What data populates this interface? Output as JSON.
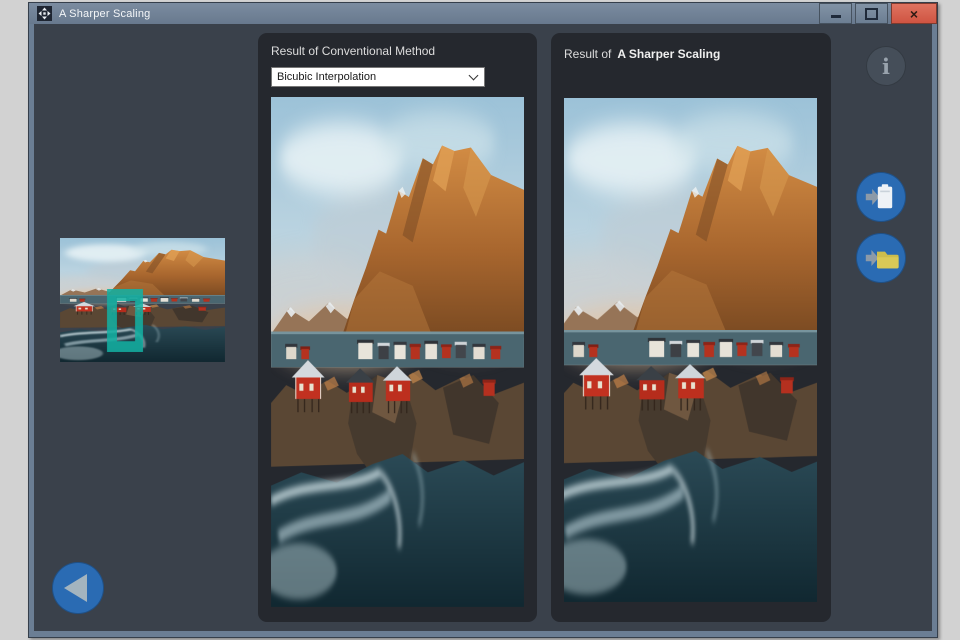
{
  "window": {
    "title": "A Sharper Scaling",
    "controls": {
      "minimize": "–",
      "maximize": "❐",
      "close": "×"
    }
  },
  "panels": {
    "conventional": {
      "header": "Result of Conventional Method",
      "method_dropdown": {
        "selected": "Bicubic Interpolation"
      }
    },
    "sharper": {
      "header_prefix": "Result of",
      "header_name": "A Sharper Scaling"
    }
  },
  "side_buttons": {
    "info_glyph": "i"
  },
  "icons": {
    "app": "scaling-arrows-icon",
    "minimize": "minimize-icon",
    "maximize": "maximize-icon",
    "close": "close-icon",
    "dropdown": "chevron-down-icon",
    "info": "info-icon",
    "clipboard": "copy-to-clipboard-icon",
    "folder": "save-to-folder-icon",
    "back": "back-arrow-icon",
    "selection": "crop-selection-overlay"
  },
  "colors": {
    "titlebar": "#6f8196",
    "window_frame": "#6b7e94",
    "desktop": "#d2d2d2",
    "content_bg": "#3a414b",
    "panel_bg": "#25282e",
    "close_button": "#d8604d",
    "accent_blue": "#2a6bb3",
    "selection_teal": "#14b0a2",
    "folder_yellow": "#cdbd4c"
  }
}
